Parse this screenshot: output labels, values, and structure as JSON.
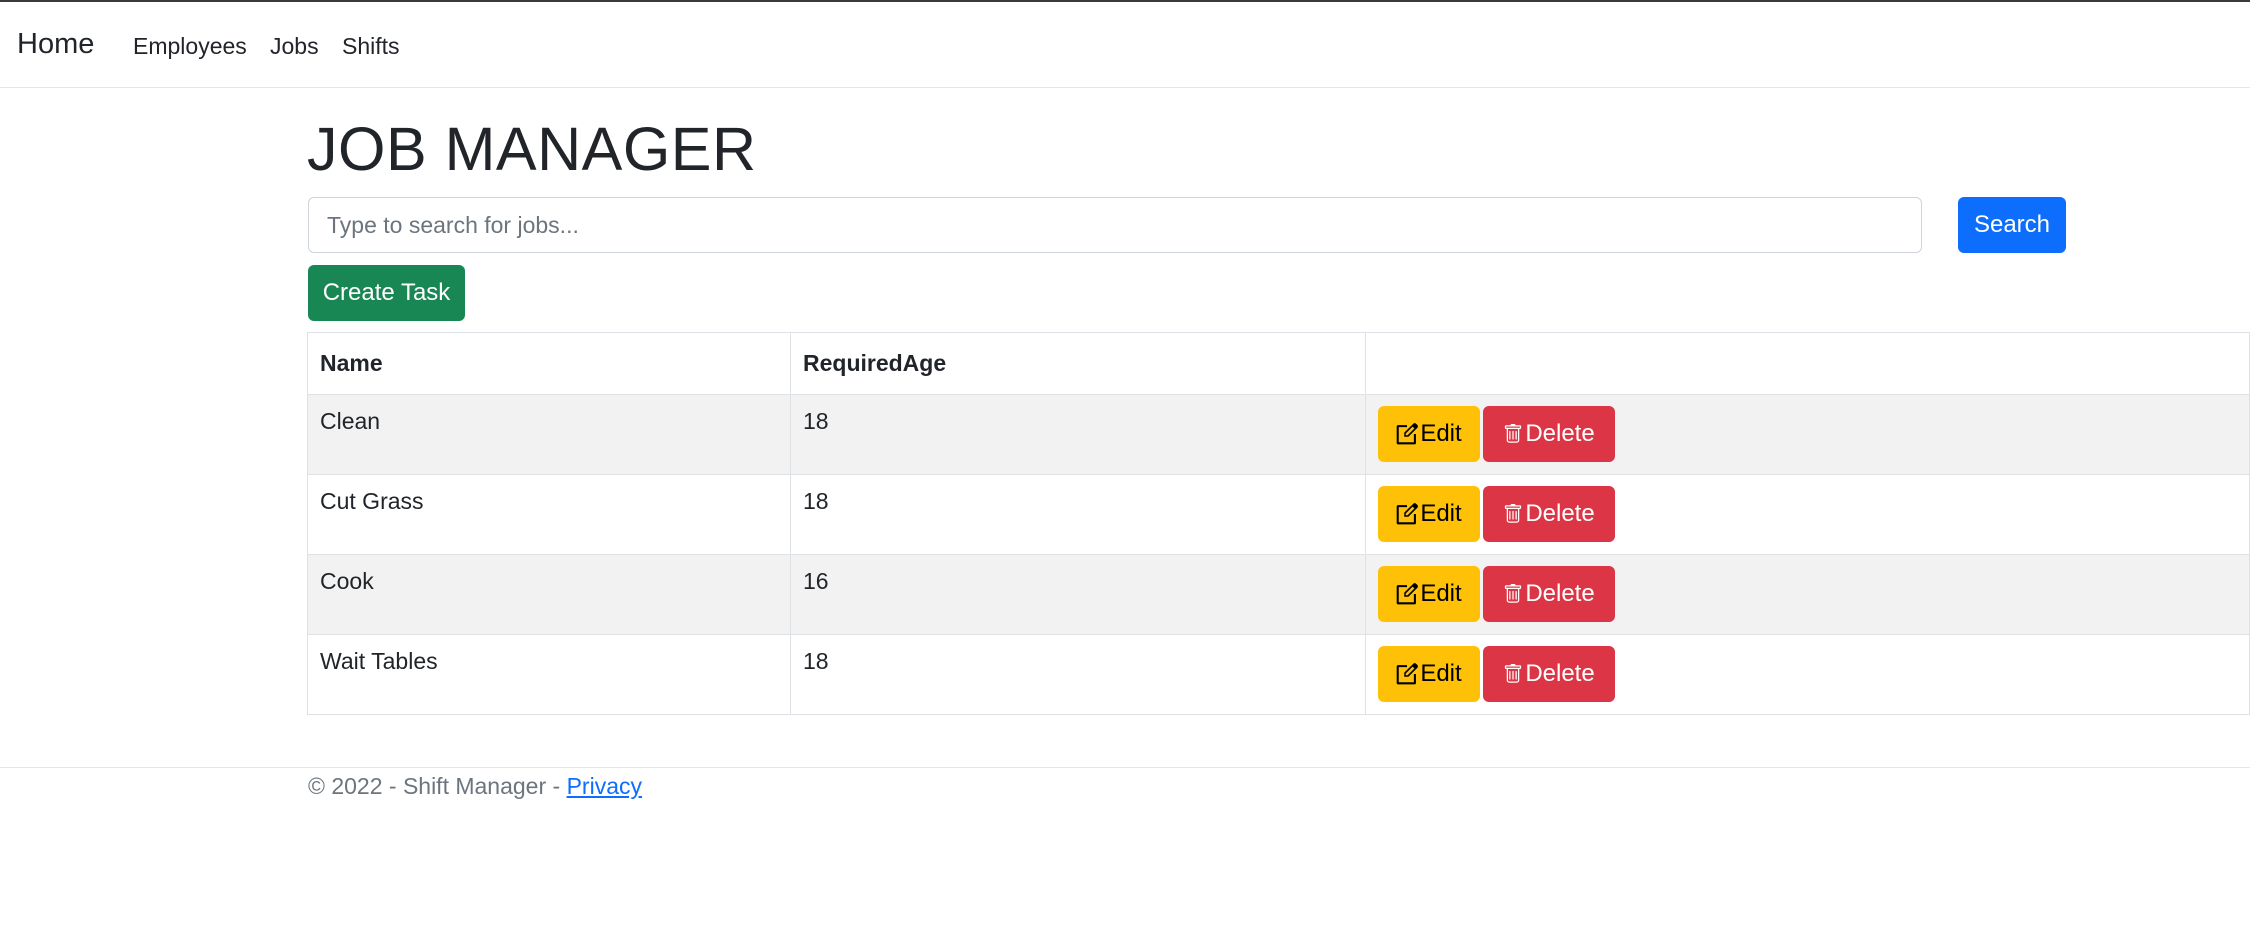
{
  "nav": {
    "brand": "Home",
    "links": [
      "Employees",
      "Jobs",
      "Shifts"
    ]
  },
  "page": {
    "title": "JOB MANAGER"
  },
  "search": {
    "placeholder": "Type to search for jobs...",
    "value": "",
    "button_label": "Search"
  },
  "toolbar": {
    "create_label": "Create Task"
  },
  "table": {
    "headers": [
      "Name",
      "RequiredAge",
      ""
    ],
    "rows": [
      {
        "name": "Clean",
        "required_age": "18"
      },
      {
        "name": "Cut Grass",
        "required_age": "18"
      },
      {
        "name": "Cook",
        "required_age": "16"
      },
      {
        "name": "Wait Tables",
        "required_age": "18"
      }
    ],
    "edit_label": "Edit",
    "delete_label": "Delete"
  },
  "footer": {
    "text": "© 2022 - Shift Manager - ",
    "privacy_label": "Privacy"
  },
  "colors": {
    "primary": "#0d6efd",
    "success": "#198754",
    "warning": "#ffc107",
    "danger": "#dc3545"
  },
  "icons": {
    "edit": "pencil-square-icon",
    "delete": "trash-icon"
  }
}
